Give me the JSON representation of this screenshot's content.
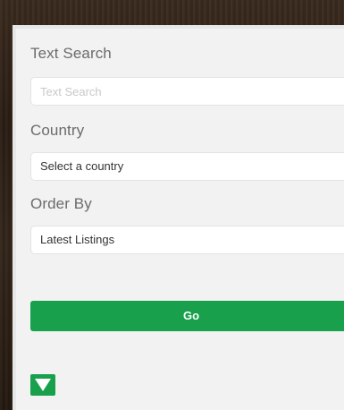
{
  "search_form": {
    "text_search_label": "Text Search",
    "text_search_placeholder": "Text Search",
    "text_search_value": "",
    "country_label": "Country",
    "country_selected": "Select a country",
    "order_label": "Order By",
    "order_selected": "Latest Listings",
    "submit_label": "Go",
    "toggle_icon": "triangle-down-icon"
  },
  "colors": {
    "accent": "#18a04c",
    "panel_bg": "#f2f2f2",
    "label_text": "#6b6b6b",
    "placeholder_text": "#c9c9c9"
  }
}
